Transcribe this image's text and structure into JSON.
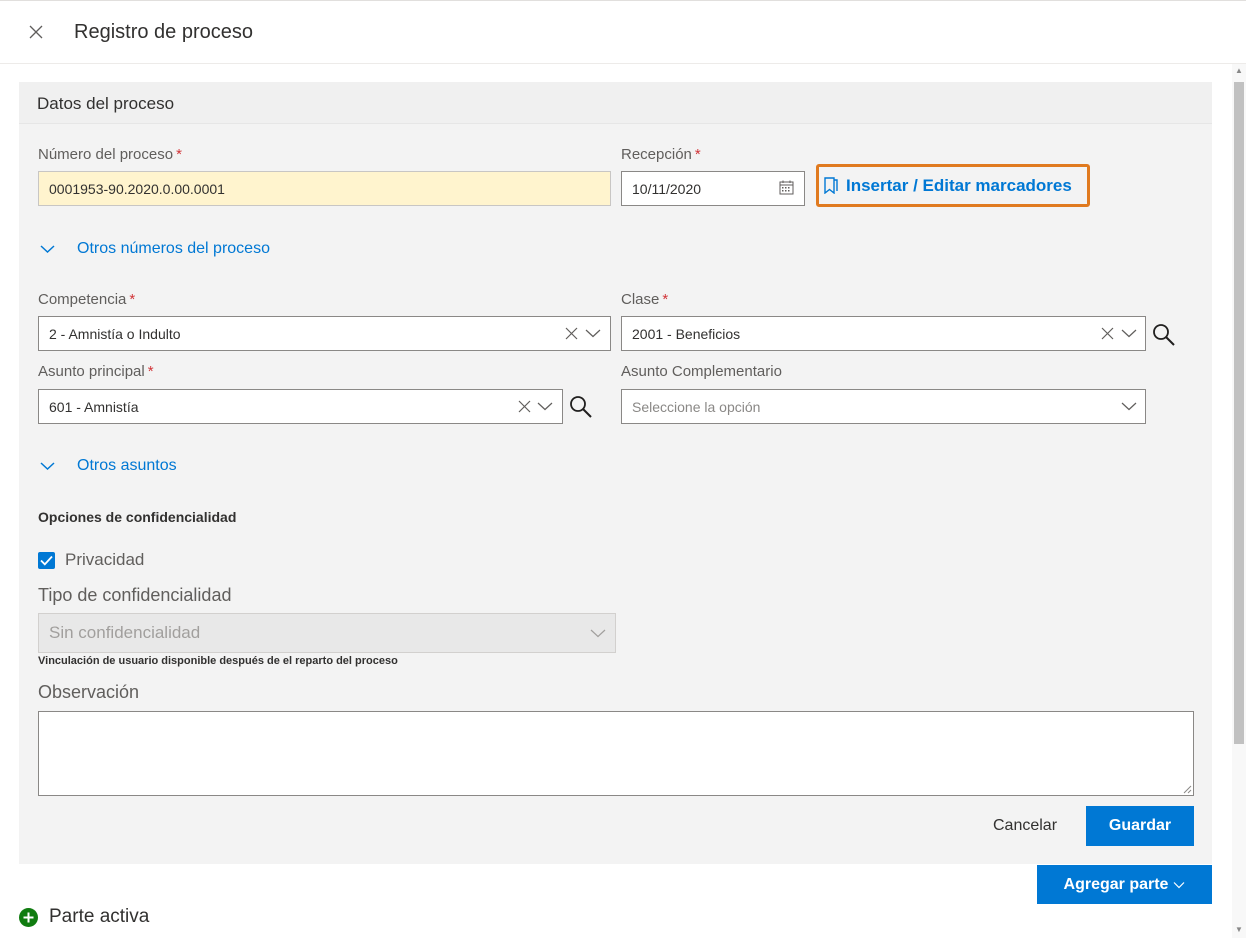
{
  "header": {
    "title": "Registro de proceso"
  },
  "panel": {
    "title": "Datos del proceso"
  },
  "numero_proceso": {
    "label": "Número del proceso",
    "value": "0001953-90.2020.0.00.0001"
  },
  "recepcion": {
    "label": "Recepción",
    "value": "10/11/2020"
  },
  "marcadores": {
    "label": "Insertar / Editar marcadores"
  },
  "otros_numeros": {
    "label": "Otros números del proceso"
  },
  "competencia": {
    "label": "Competencia",
    "value": "2 - Amnistía o Indulto"
  },
  "clase": {
    "label": "Clase",
    "value": "2001 - Beneficios"
  },
  "asunto_principal": {
    "label": "Asunto principal",
    "value": "601 - Amnistía"
  },
  "asunto_complementario": {
    "label": "Asunto Complementario",
    "placeholder": "Seleccione la opción"
  },
  "otros_asuntos": {
    "label": "Otros asuntos"
  },
  "confidencialidad": {
    "title": "Opciones de confidencialidad",
    "privacidad_label": "Privacidad",
    "privacidad_checked": true,
    "tipo_label": "Tipo de confidencialidad",
    "tipo_value": "Sin confidencialidad",
    "note": "Vinculación de usuario disponible después de el reparto del proceso"
  },
  "observacion": {
    "label": "Observación",
    "value": ""
  },
  "actions": {
    "cancel": "Cancelar",
    "save": "Guardar",
    "agregar": "Agregar parte"
  },
  "parte_activa": {
    "label": "Parte activa"
  },
  "required_mark": "*",
  "colors": {
    "accent": "#0078d4",
    "highlight": "#e07a1f",
    "yellow_field": "#fff4ce",
    "required": "#d13438",
    "success": "#107c10"
  }
}
